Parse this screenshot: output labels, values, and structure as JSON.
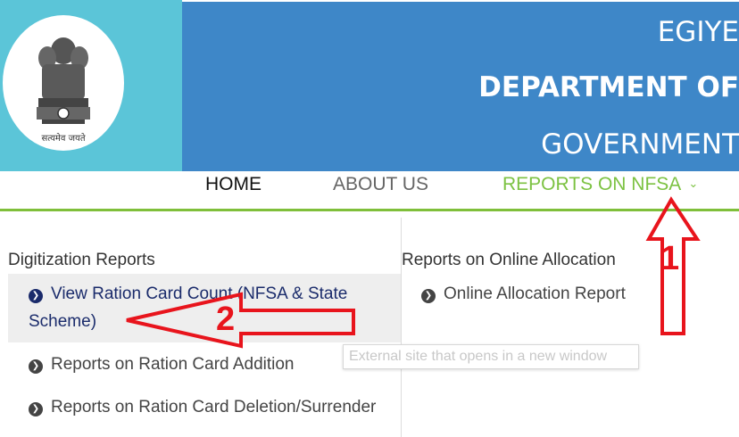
{
  "header": {
    "emblem_motto": "सत्यमेव जयते",
    "banner_lines": [
      "EGIYE",
      "DEPARTMENT OF",
      "GOVERNMENT"
    ]
  },
  "nav": {
    "home": "HOME",
    "about": "ABOUT US",
    "reports": "REPORTS ON NFSA",
    "reports_chevron": "⌄"
  },
  "dropdown": {
    "digitization": {
      "heading": "Digitization Reports",
      "items": [
        "View Ration Card Count (NFSA & State Scheme)",
        "Reports on Ration Card Addition",
        "Reports on Ration Card Deletion/Surrender"
      ]
    },
    "online_allocation": {
      "heading": "Reports on Online Allocation",
      "items": [
        "Online Allocation Report"
      ]
    }
  },
  "tooltip": "External site that opens in a new window",
  "annotations": {
    "step1": "1",
    "step2": "2",
    "arrow_color": "#e8141c"
  },
  "colors": {
    "banner_blue": "#3e87c8",
    "logo_teal": "#5bc5d8",
    "nav_active_green": "#7cc242",
    "active_link_navy": "#1a2b6b"
  }
}
